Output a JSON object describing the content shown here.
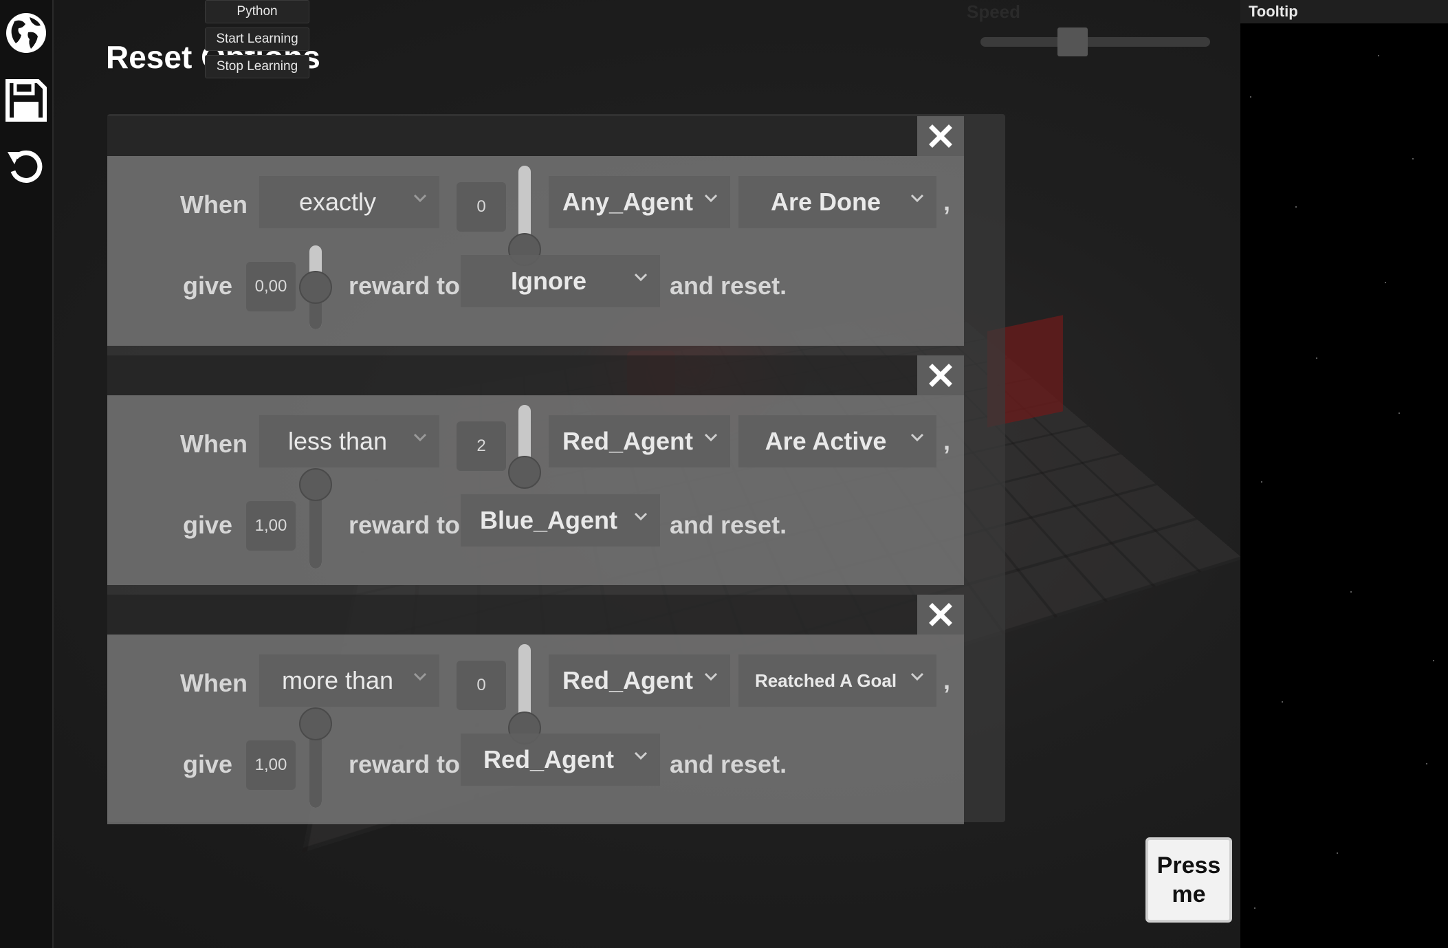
{
  "python_menu": {
    "title": "Python",
    "start_label": "Start Learning",
    "stop_label": "Stop Learning"
  },
  "page_title": "Reset Options",
  "speed": {
    "label": "Speed",
    "value": 0.4
  },
  "tooltip": {
    "title": "Tooltip"
  },
  "sidebar_icons": [
    "globe-icon",
    "save-icon",
    "undo-icon"
  ],
  "rules": [
    {
      "when_label": "When",
      "comparator": "exactly",
      "count": "0",
      "count_level": 0.0,
      "agent": "Any_Agent",
      "condition": "Are Done",
      "comma": ",",
      "give_label": "give",
      "reward": "0,00",
      "reward_level": 0.5,
      "reward_to_label": "reward to",
      "target": "Ignore",
      "and_reset_label": "and reset."
    },
    {
      "when_label": "When",
      "comparator": "less than",
      "count": "2",
      "count_level": 0.2,
      "agent": "Red_Agent",
      "condition": "Are Active",
      "comma": ",",
      "give_label": "give",
      "reward": "1,00",
      "reward_level": 1.0,
      "reward_to_label": "reward to",
      "target": "Blue_Agent",
      "and_reset_label": "and reset."
    },
    {
      "when_label": "When",
      "comparator": "more than",
      "count": "0",
      "count_level": 0.0,
      "agent": "Red_Agent",
      "condition": "Reatched A Goal",
      "comma": ",",
      "give_label": "give",
      "reward": "1,00",
      "reward_level": 1.0,
      "reward_to_label": "reward to",
      "target": "Red_Agent",
      "and_reset_label": "and reset."
    }
  ],
  "press_button": "Press me",
  "colors": {
    "panel": "#787878",
    "accent_red": "#6b1a1a",
    "background": "#1b1b1b"
  }
}
